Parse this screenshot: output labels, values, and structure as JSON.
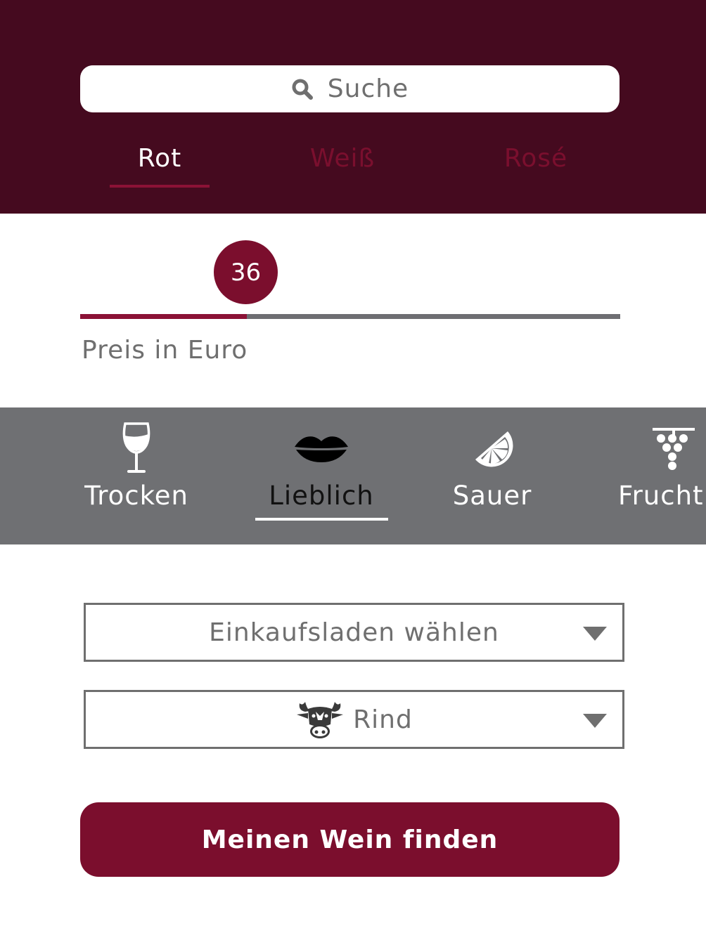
{
  "search": {
    "placeholder": "Suche",
    "icon": "search-icon"
  },
  "wine_tabs": [
    {
      "label": "Rot",
      "selected": true
    },
    {
      "label": "Weiß",
      "selected": false
    },
    {
      "label": "Rosé",
      "selected": false
    }
  ],
  "price": {
    "value": "36",
    "label": "Preis in Euro",
    "fill_fraction": 0.308
  },
  "taste": [
    {
      "label": "Trocken",
      "icon": "wine-glass-icon",
      "selected": false
    },
    {
      "label": "Lieblich",
      "icon": "lips-icon",
      "selected": true
    },
    {
      "label": "Sauer",
      "icon": "lemon-slice-icon",
      "selected": false
    },
    {
      "label": "Frucht",
      "icon": "grapes-icon",
      "selected": false
    }
  ],
  "store_select": {
    "value": "Einkaufsladen wählen"
  },
  "food_select": {
    "value": "Rind",
    "icon": "cow-icon"
  },
  "find_button": {
    "label": "Meinen Wein finden"
  },
  "colors": {
    "header": "#450a1f",
    "accent": "#7b0e2d",
    "taste_bar": "#6f7073",
    "text_gray": "#6f6f6f"
  }
}
